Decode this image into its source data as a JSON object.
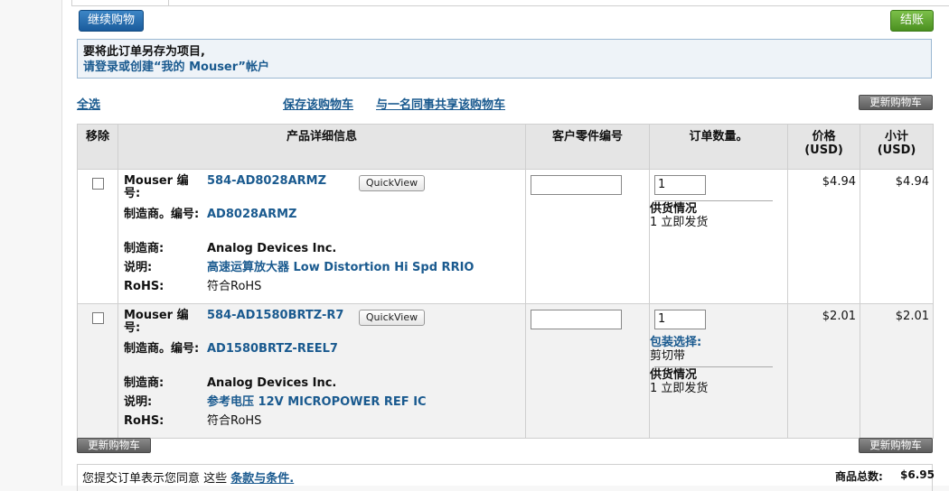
{
  "header": {
    "continue_label": "继续购物",
    "checkout_label": "结账"
  },
  "login_notice": {
    "line1": "要将此订单另存为项目,",
    "line2": "请登录或创建“我的 Mouser”帐户"
  },
  "actions": {
    "select_all": "全选",
    "save_cart": "保存该购物车",
    "share_cart": "与一名同事共享该购物车",
    "update_cart": "更新购物车"
  },
  "table": {
    "headers": {
      "remove": "移除",
      "details": "产品详细信息",
      "customer_part": "客户零件编号",
      "quantity": "订单数量。",
      "price": "价格\n(USD)",
      "subtotal": "小计\n(USD)"
    },
    "labels": {
      "mouser_no": "Mouser 编号:",
      "mfr_no": "制造商。编号:",
      "mfr": "制造商:",
      "desc": "说明:",
      "rohs": "RoHS:",
      "quickview": "QuickView",
      "availability": "供货情况",
      "packaging": "包装选择:"
    },
    "rows": [
      {
        "mouser_no": "584-AD8028ARMZ",
        "mfr_no": "AD8028ARMZ",
        "mfr": "Analog Devices Inc.",
        "desc": "高速运算放大器 Low Distortion Hi Spd RRIO",
        "rohs": "符合RoHS",
        "qty": "1",
        "availability": "1 立即发货",
        "price": "$4.94",
        "subtotal": "$4.94"
      },
      {
        "mouser_no": "584-AD1580BRTZ-R7",
        "mfr_no": "AD1580BRTZ-REEL7",
        "mfr": "Analog Devices Inc.",
        "desc": "参考电压 12V MICROPOWER REF IC",
        "rohs": "符合RoHS",
        "qty": "1",
        "packaging": "剪切带",
        "availability": "1 立即发货",
        "price": "$2.01",
        "subtotal": "$2.01"
      }
    ]
  },
  "footer": {
    "terms_prefix": "您提交订单表示您同意 这些",
    "terms_link": "条款与条件.",
    "total_label": "商品总数:",
    "total_value": "$6.95"
  },
  "colors": {
    "link_blue": "#1a5a8f",
    "button_blue": "#1a5b9c",
    "button_green": "#4a8f1f",
    "button_gray": "#5c5c5c"
  }
}
